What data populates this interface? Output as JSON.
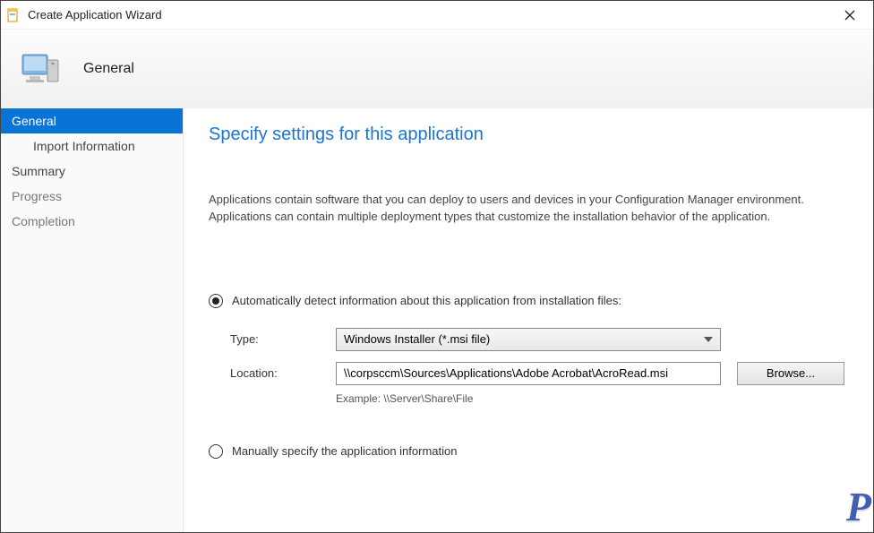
{
  "titlebar": {
    "title": "Create Application Wizard"
  },
  "header": {
    "stage": "General"
  },
  "sidebar": {
    "items": [
      {
        "label": "General",
        "active": true
      },
      {
        "label": "Import Information",
        "sub": true
      },
      {
        "label": "Summary"
      },
      {
        "label": "Progress",
        "muted": true
      },
      {
        "label": "Completion",
        "muted": true
      }
    ]
  },
  "content": {
    "title": "Specify settings for this application",
    "description": "Applications contain software that you can deploy to users and devices in your Configuration Manager environment. Applications can contain multiple deployment types that customize the installation behavior of the application.",
    "radio_auto": "Automatically detect information about this application from installation files:",
    "type_label": "Type:",
    "type_value": "Windows Installer (*.msi file)",
    "location_label": "Location:",
    "location_value": "\\\\corpsccm\\Sources\\Applications\\Adobe Acrobat\\AcroRead.msi",
    "example_label": "Example: \\\\Server\\Share\\File",
    "browse_label": "Browse...",
    "radio_manual": "Manually specify the application information"
  },
  "watermark": "P"
}
